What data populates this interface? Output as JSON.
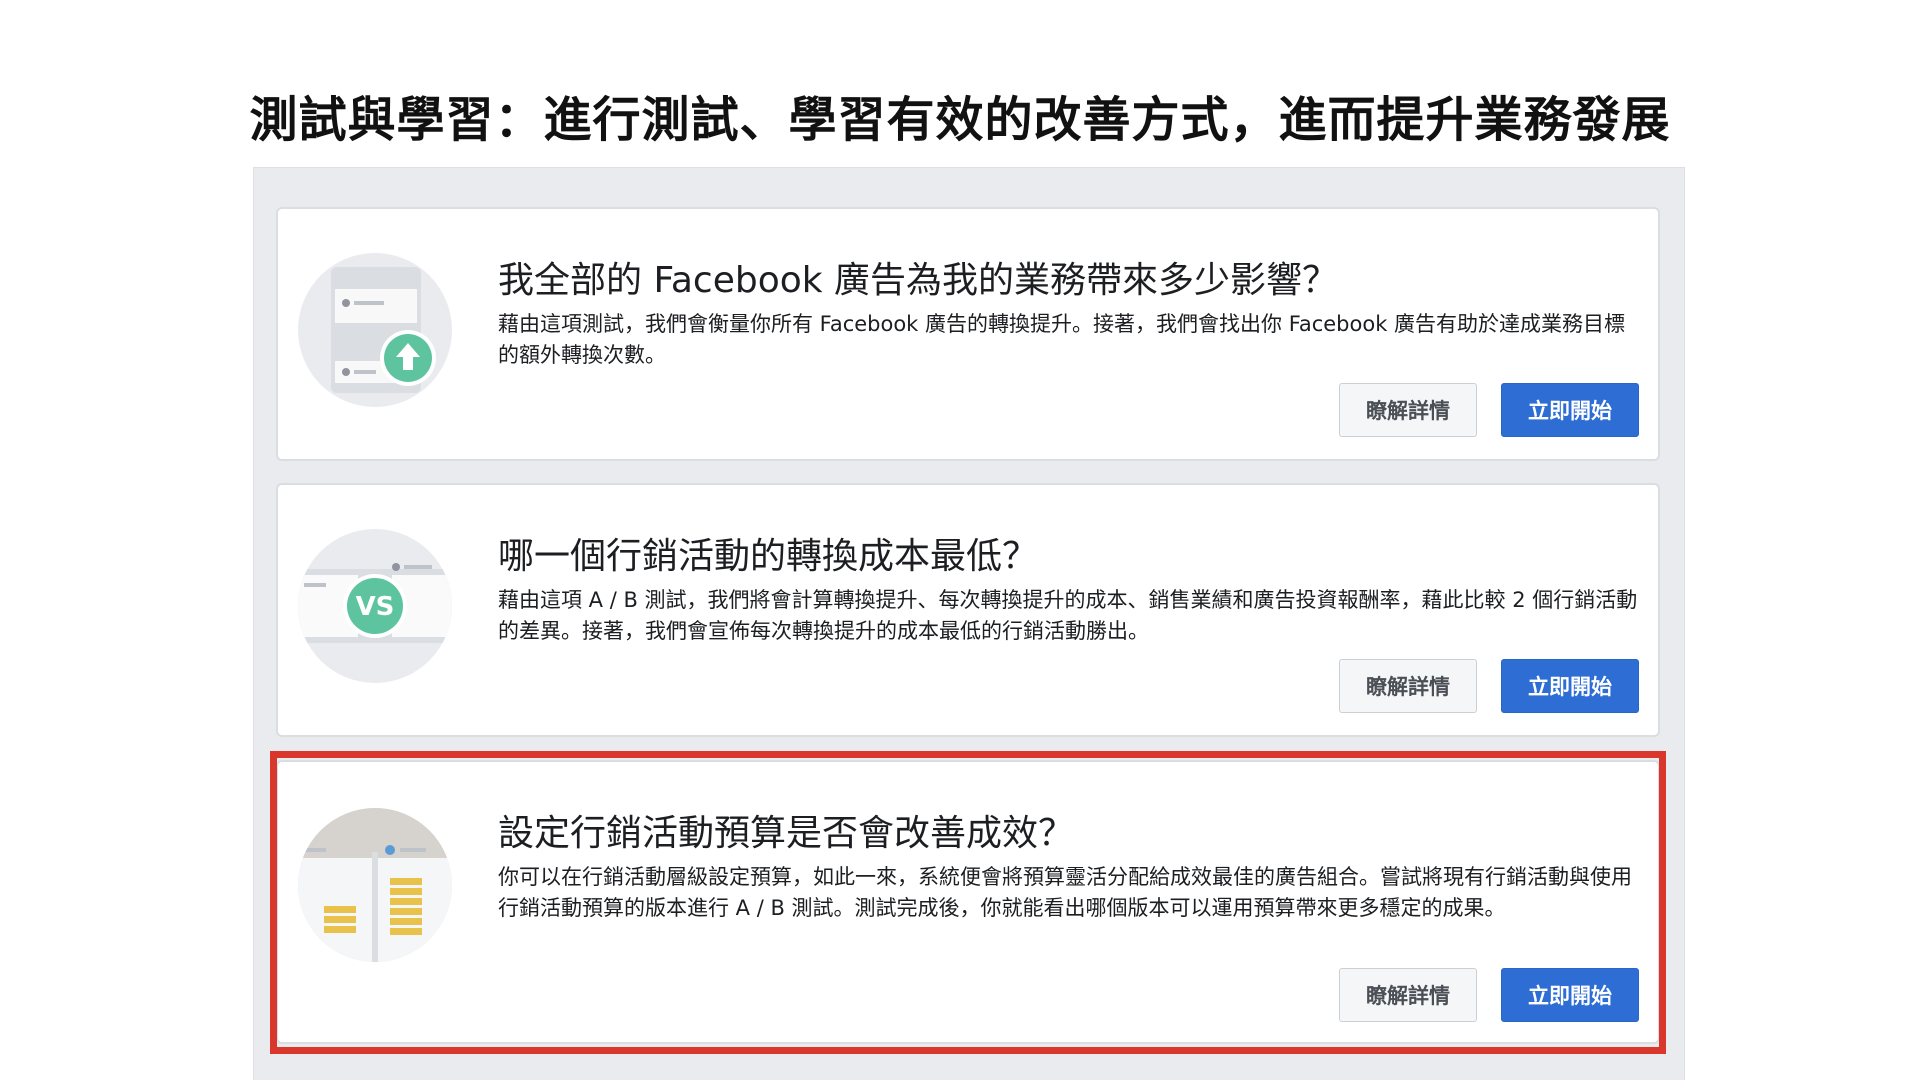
{
  "page": {
    "title": "測試與學習：進行測試、學習有效的改善方式，進而提升業務發展"
  },
  "tests": [
    {
      "title": "我全部的 Facebook 廣告為我的業務帶來多少影響？",
      "description": "藉由這項測試，我們會衡量你所有 Facebook 廣告的轉換提升。接著，我們會找出你 Facebook 廣告有助於達成業務目標的額外轉換次數。",
      "learn_more_label": "瞭解詳情",
      "start_label": "立即開始",
      "icon": "conversion-lift-icon"
    },
    {
      "title": "哪一個行銷活動的轉換成本最低？",
      "description": "藉由這項 A / B 測試，我們將會計算轉換提升、每次轉換提升的成本、銷售業績和廣告投資報酬率，藉此比較 2 個行銷活動的差異。接著，我們會宣佈每次轉換提升的成本最低的行銷活動勝出。",
      "learn_more_label": "瞭解詳情",
      "start_label": "立即開始",
      "icon": "ab-test-icon",
      "badge": "VS"
    },
    {
      "title": "設定行銷活動預算是否會改善成效？",
      "description": "你可以在行銷活動層級設定預算，如此一來，系統便會將預算靈活分配給成效最佳的廣告組合。嘗試將現有行銷活動與使用行銷活動預算的版本進行 A / B 測試。測試完成後，你就能看出哪個版本可以運用預算帶來更多穩定的成果。",
      "learn_more_label": "瞭解詳情",
      "start_label": "立即開始",
      "icon": "budget-coins-icon",
      "highlighted": true
    }
  ],
  "colors": {
    "primary_button": "#2d6dd4",
    "highlight_border": "#d9372b",
    "accent_green": "#5ec4a0",
    "coin_yellow": "#e8c24a"
  }
}
